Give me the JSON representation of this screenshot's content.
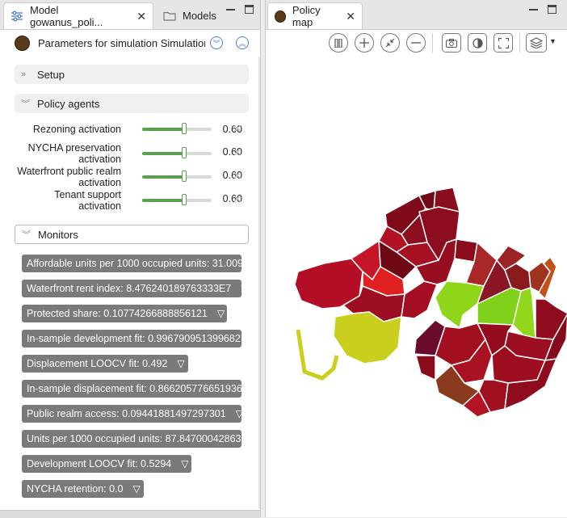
{
  "left_panel": {
    "tabs": [
      {
        "label": "Model gowanus_poli...",
        "icon": "sliders-icon"
      },
      {
        "label": "Models",
        "icon": "folder-icon"
      }
    ],
    "params_title": "Parameters for simulation Simulation",
    "sections": {
      "setup": "Setup",
      "policy_agents": "Policy agents",
      "monitors": "Monitors"
    },
    "sliders": [
      {
        "label": "Rezoning activation",
        "value": "0.60",
        "level": 0.6
      },
      {
        "label": "NYCHA preservation activation",
        "value": "0.60",
        "level": 0.6
      },
      {
        "label": "Waterfront public realm activation",
        "value": "0.60",
        "level": 0.6
      },
      {
        "label": "Tenant support activation",
        "value": "0.60",
        "level": 0.6
      }
    ],
    "monitors": [
      {
        "text": "Affordable units per 1000 occupied units: 31.009",
        "dropdown": false
      },
      {
        "text": "Waterfront rent index: 8.476240189763333E7",
        "dropdown": true
      },
      {
        "text": "Protected share: 0.10774266888856121",
        "dropdown": true
      },
      {
        "text": "In-sample development fit: 0.996790951399682",
        "dropdown": false
      },
      {
        "text": "Displacement LOOCV fit: 0.492",
        "dropdown": true
      },
      {
        "text": "In-sample displacement fit: 0.866205776651936",
        "dropdown": false
      },
      {
        "text": "Public realm access: 0.09441881497297301",
        "dropdown": true
      },
      {
        "text": "Units per 1000 occupied units: 87.84700042863",
        "dropdown": false
      },
      {
        "text": "Development LOOCV fit: 0.5294",
        "dropdown": true
      },
      {
        "text": "NYCHA retention: 0.0",
        "dropdown": true
      }
    ]
  },
  "right_panel": {
    "tab": {
      "label": "Policy map"
    },
    "toolbar": [
      "pause-icon",
      "zoom-in-icon",
      "zoom-fit-icon",
      "zoom-out-icon",
      "camera-icon",
      "contrast-icon",
      "fullscreen-icon",
      "layers-icon"
    ]
  },
  "colors": {
    "agent_dot": "#5b3a1a",
    "accent": "#4b7fd1",
    "slider": "#5aa04f",
    "monitor_bg": "#7a7a7a"
  }
}
